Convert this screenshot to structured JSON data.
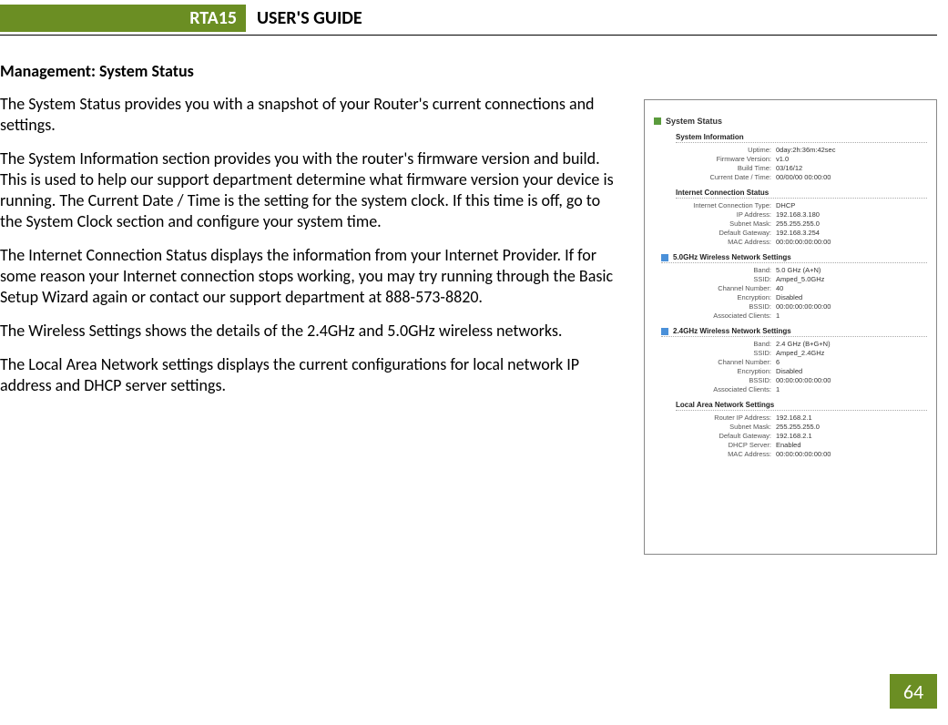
{
  "header": {
    "product": "RTA15",
    "title": "USER'S GUIDE"
  },
  "page_number": "64",
  "section_title": "Management: System Status",
  "paragraphs": [
    "The System Status provides you with a snapshot of your Router's current connections and settings.",
    "The System Information section provides you with the router's firmware version and build.  This is used to help our support department determine what firmware version your device is running.  The Current Date / Time is the setting for the system clock.  If this time is off, go to the System Clock section and configure your system time.",
    "The Internet Connection Status displays the information from your Internet Provider.  If for some reason your Internet connection stops working, you may try running through the Basic Setup Wizard again or contact our support department at 888-573-8820.",
    "The Wireless Settings shows the details of the 2.4GHz and 5.0GHz wireless networks.",
    "The Local Area Network settings displays the current configurations for local network IP address and DHCP server settings."
  ],
  "screenshot": {
    "title": "System Status",
    "system_information": {
      "title": "System Information",
      "rows": [
        {
          "k": "Uptime:",
          "v": "0day:2h:36m:42sec"
        },
        {
          "k": "Firmware Version:",
          "v": "v1.0"
        },
        {
          "k": "Build Time:",
          "v": "03/16/12"
        },
        {
          "k": "Current Date / Time:",
          "v": "00/00/00 00:00:00"
        }
      ]
    },
    "internet_connection": {
      "title": "Internet Connection Status",
      "rows": [
        {
          "k": "Internet Connection Type:",
          "v": "DHCP"
        },
        {
          "k": "IP Address:",
          "v": "192.168.3.180"
        },
        {
          "k": "Subnet Mask:",
          "v": "255.255.255.0"
        },
        {
          "k": "Default Gateway:",
          "v": "192.168.3.254"
        },
        {
          "k": "MAC Address:",
          "v": "00:00:00:00:00:00"
        }
      ]
    },
    "wireless5": {
      "title": "5.0GHz Wireless Network Settings",
      "rows": [
        {
          "k": "Band:",
          "v": "5.0 GHz (A+N)"
        },
        {
          "k": "SSID:",
          "v": "Amped_5.0GHz"
        },
        {
          "k": "Channel Number:",
          "v": "40"
        },
        {
          "k": "Encryption:",
          "v": "Disabled"
        },
        {
          "k": "BSSID:",
          "v": "00:00:00:00:00:00"
        },
        {
          "k": "Associated Clients:",
          "v": "1"
        }
      ]
    },
    "wireless24": {
      "title": "2.4GHz Wireless Network Settings",
      "rows": [
        {
          "k": "Band:",
          "v": "2.4 GHz (B+G+N)"
        },
        {
          "k": "SSID:",
          "v": "Amped_2.4GHz"
        },
        {
          "k": "Channel Number:",
          "v": "6"
        },
        {
          "k": "Encryption:",
          "v": "Disabled"
        },
        {
          "k": "BSSID:",
          "v": "00:00:00:00:00:00"
        },
        {
          "k": "Associated Clients:",
          "v": "1"
        }
      ]
    },
    "lan": {
      "title": "Local Area Network Settings",
      "rows": [
        {
          "k": "Router IP Address:",
          "v": "192.168.2.1"
        },
        {
          "k": "Subnet Mask:",
          "v": "255.255.255.0"
        },
        {
          "k": "Default Gateway:",
          "v": "192.168.2.1"
        },
        {
          "k": "DHCP Server:",
          "v": "Enabled"
        },
        {
          "k": "MAC Address:",
          "v": "00:00:00:00:00:00"
        }
      ]
    }
  }
}
